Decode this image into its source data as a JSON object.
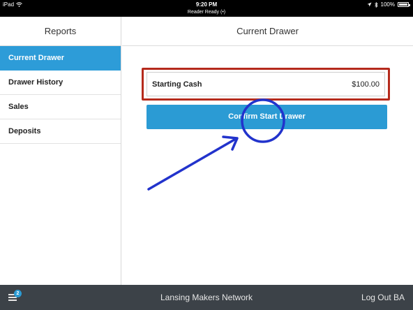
{
  "status_bar": {
    "device": "iPad",
    "time": "9:20 PM",
    "reader_status": "Reader Ready",
    "battery": "100%",
    "icons": [
      "wifi-icon",
      "bluetooth-icon",
      "location-icon",
      "battery-icon"
    ]
  },
  "sidebar": {
    "title": "Reports",
    "items": [
      {
        "label": "Current Drawer",
        "active": true
      },
      {
        "label": "Drawer History",
        "active": false
      },
      {
        "label": "Sales",
        "active": false
      },
      {
        "label": "Deposits",
        "active": false
      }
    ]
  },
  "main": {
    "title": "Current Drawer",
    "starting_cash_label": "Starting Cash",
    "starting_cash_value": "$100.00",
    "confirm_label": "Confirm Start Drawer"
  },
  "bottom_bar": {
    "badge_count": "2",
    "network_name": "Lansing Makers Network",
    "logout_label": "Log Out BA"
  },
  "colors": {
    "accent": "#2b9bd4",
    "highlight": "#b52a1c",
    "annotation": "#2233cc",
    "bottom_bar": "#3c4248"
  }
}
